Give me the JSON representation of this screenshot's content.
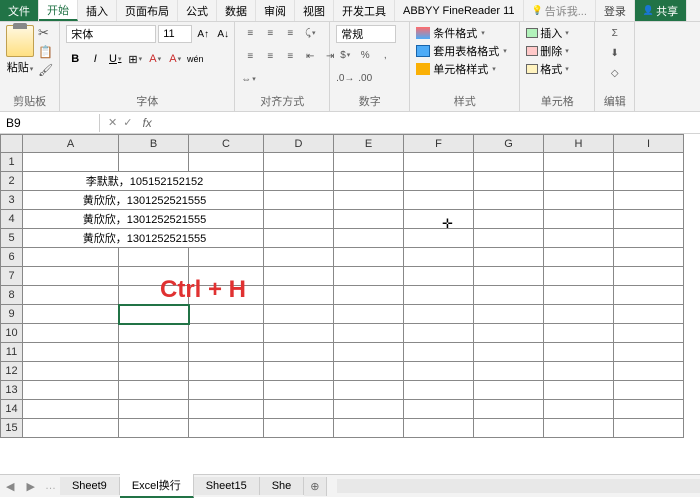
{
  "tabs": {
    "file": "文件",
    "home": "开始",
    "insert": "插入",
    "layout": "页面布局",
    "formulas": "公式",
    "data": "数据",
    "review": "审阅",
    "view": "视图",
    "dev": "开发工具",
    "abbyy": "ABBYY FineReader 11",
    "tell": "告诉我...",
    "login": "登录",
    "share": "共享"
  },
  "ribbon": {
    "clipboard": {
      "label": "剪贴板",
      "paste": "粘贴"
    },
    "font": {
      "label": "字体",
      "name": "宋体",
      "size": "11",
      "bold": "B",
      "italic": "I",
      "underline": "U",
      "ruby": "wén"
    },
    "align": {
      "label": "对齐方式"
    },
    "number": {
      "label": "数字",
      "format": "常规"
    },
    "styles": {
      "label": "样式",
      "cond": "条件格式",
      "table": "套用表格格式",
      "cell": "单元格样式"
    },
    "cells": {
      "label": "单元格",
      "insert": "插入",
      "delete": "删除",
      "format": "格式"
    },
    "edit": {
      "label": "编辑"
    }
  },
  "bar": {
    "nameBox": "B9",
    "fx": "fx"
  },
  "grid": {
    "cols": [
      "A",
      "B",
      "C",
      "D",
      "E",
      "F",
      "G",
      "H",
      "I"
    ],
    "rows": [
      "1",
      "2",
      "3",
      "4",
      "5",
      "6",
      "7",
      "8",
      "9",
      "10",
      "11",
      "12",
      "13",
      "14",
      "15"
    ],
    "data": {
      "A2": "李默默，105152152152",
      "A3": "黄欣欣，1301252521555",
      "A4": "黄欣欣，1301252521555",
      "A5": "黄欣欣，1301252521555"
    },
    "overlay": "Ctrl + H",
    "selected": "B9"
  },
  "sheetTabs": {
    "left": "Sheet9",
    "active": "Excel换行",
    "right": "Sheet15",
    "partial": "She"
  }
}
